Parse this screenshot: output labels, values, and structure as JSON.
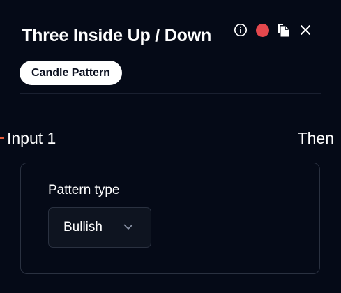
{
  "node": {
    "title": "Three Inside Up / Down",
    "badge": "Candle Pattern"
  },
  "header_icons": [
    {
      "name": "info-icon"
    },
    {
      "name": "status-dot",
      "color": "#e5484d"
    },
    {
      "name": "copy-icon"
    },
    {
      "name": "close-icon"
    }
  ],
  "ports": {
    "input_label": "Input 1",
    "output_label": "Then",
    "input_marker_color": "#e05a3a"
  },
  "config": {
    "pattern_type_label": "Pattern type",
    "pattern_type_value": "Bullish"
  },
  "colors": {
    "background": "#050a17",
    "panel_border": "#2a3140",
    "badge_background": "#ffffff"
  }
}
